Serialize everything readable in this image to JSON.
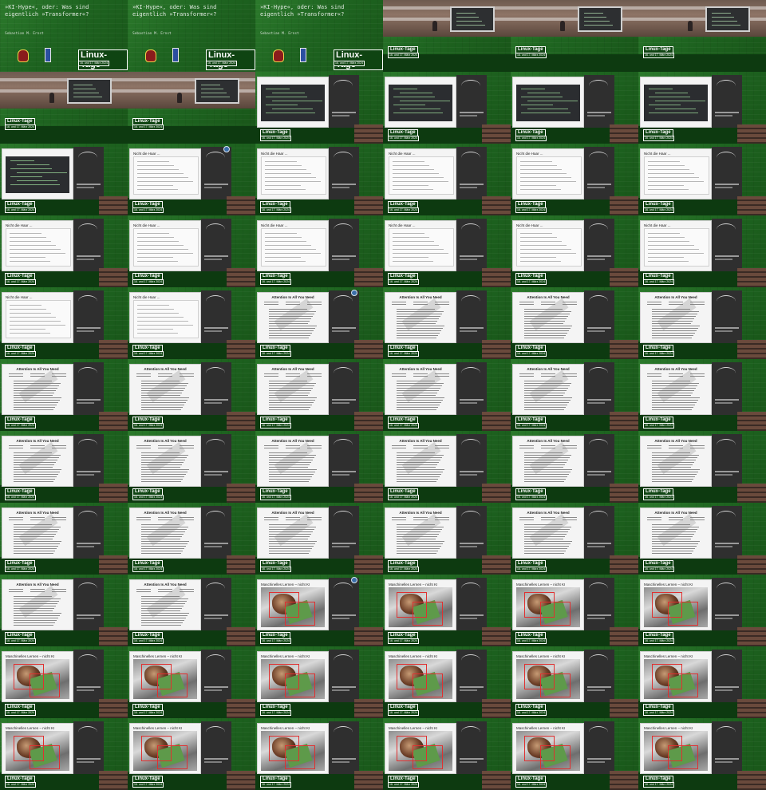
{
  "title_slide": {
    "title": "»KI-Hype«, oder: Was sind\neigentlich »Transformer«?",
    "author": "Sebastian M. Ernst"
  },
  "logo": {
    "main": "Linux-Tage",
    "date": "16. und 17. März 2024"
  },
  "slides": {
    "nicht_die_haar": "Nicht die Haar ...",
    "attention": "Attention Is All You Need",
    "maschinelles_lernen": "Maschinelles Lernen – nicht KI"
  },
  "frames": [
    "title",
    "title",
    "title",
    "cam",
    "cam",
    "cam",
    "cam",
    "cam",
    "term",
    "term",
    "term",
    "term",
    "term",
    "form",
    "form",
    "form",
    "form",
    "form",
    "form",
    "form",
    "form",
    "form",
    "form",
    "form",
    "form",
    "form",
    "paper",
    "paper",
    "paper",
    "paper",
    "paper",
    "paper",
    "paper",
    "paper",
    "paper",
    "paper",
    "paper",
    "paper",
    "paper",
    "paper",
    "paper",
    "paper",
    "paper",
    "paper",
    "paper",
    "paper",
    "paper",
    "paper",
    "paper",
    "paper",
    "photo",
    "photo",
    "photo",
    "photo",
    "photo",
    "photo",
    "photo",
    "photo",
    "photo",
    "photo",
    "photo",
    "photo",
    "photo",
    "photo",
    "photo",
    "photo"
  ],
  "colors": {
    "background": "#1f5e1f",
    "bar": "#0d3a10",
    "slide": "#f4f4f4",
    "accent_red": "#e03030"
  }
}
